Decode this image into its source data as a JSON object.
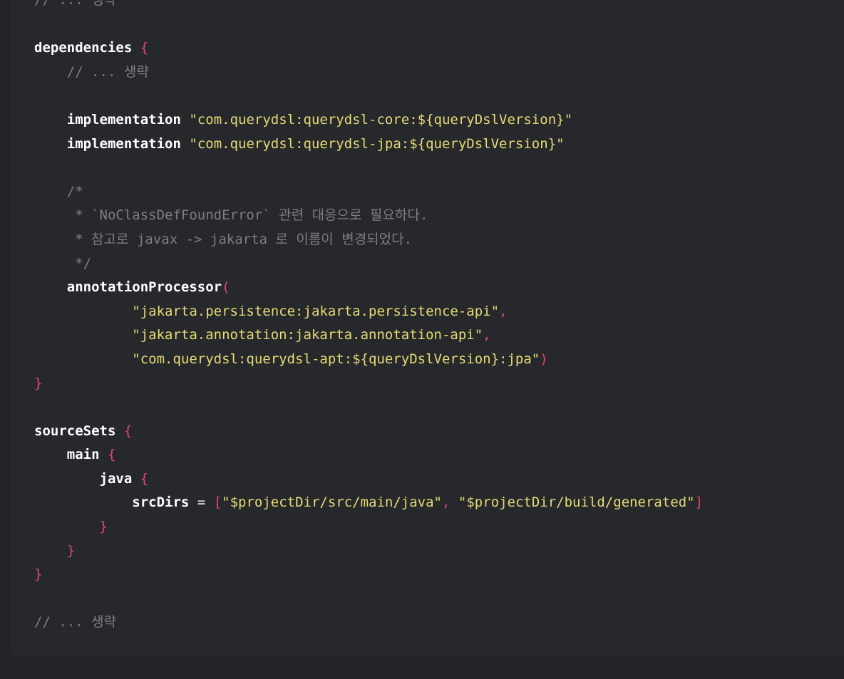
{
  "colors": {
    "page_background": "#222326",
    "code_background": "#26282c",
    "keyword": "#ffffff",
    "string": "#e6db74",
    "punctuation": "#e0476d",
    "comment": "#7c7e82"
  },
  "code_lines": [
    {
      "tokens": [
        {
          "t": "cmt",
          "v": "// ... 생략"
        }
      ]
    },
    {
      "tokens": []
    },
    {
      "tokens": [
        {
          "t": "kw",
          "v": "dependencies"
        },
        {
          "t": "op",
          "v": " "
        },
        {
          "t": "punc",
          "v": "{"
        }
      ]
    },
    {
      "tokens": [
        {
          "t": "op",
          "v": "    "
        },
        {
          "t": "cmt",
          "v": "// ... 생략"
        }
      ]
    },
    {
      "tokens": []
    },
    {
      "tokens": [
        {
          "t": "op",
          "v": "    "
        },
        {
          "t": "kw",
          "v": "implementation"
        },
        {
          "t": "op",
          "v": " "
        },
        {
          "t": "str",
          "v": "\"com.querydsl:querydsl-core:${queryDslVersion}\""
        }
      ]
    },
    {
      "tokens": [
        {
          "t": "op",
          "v": "    "
        },
        {
          "t": "kw",
          "v": "implementation"
        },
        {
          "t": "op",
          "v": " "
        },
        {
          "t": "str",
          "v": "\"com.querydsl:querydsl-jpa:${queryDslVersion}\""
        }
      ]
    },
    {
      "tokens": []
    },
    {
      "tokens": [
        {
          "t": "op",
          "v": "    "
        },
        {
          "t": "cmt",
          "v": "/*"
        }
      ]
    },
    {
      "tokens": [
        {
          "t": "op",
          "v": "     "
        },
        {
          "t": "cmt",
          "v": "* `NoClassDefFoundError` 관련 대응으로 필요하다."
        }
      ]
    },
    {
      "tokens": [
        {
          "t": "op",
          "v": "     "
        },
        {
          "t": "cmt",
          "v": "* 참고로 javax -> jakarta 로 이름이 변경되었다."
        }
      ]
    },
    {
      "tokens": [
        {
          "t": "op",
          "v": "     "
        },
        {
          "t": "cmt",
          "v": "*/"
        }
      ]
    },
    {
      "tokens": [
        {
          "t": "op",
          "v": "    "
        },
        {
          "t": "kw",
          "v": "annotationProcessor"
        },
        {
          "t": "punc",
          "v": "("
        }
      ]
    },
    {
      "tokens": [
        {
          "t": "op",
          "v": "            "
        },
        {
          "t": "str",
          "v": "\"jakarta.persistence:jakarta.persistence-api\""
        },
        {
          "t": "punc",
          "v": ","
        }
      ]
    },
    {
      "tokens": [
        {
          "t": "op",
          "v": "            "
        },
        {
          "t": "str",
          "v": "\"jakarta.annotation:jakarta.annotation-api\""
        },
        {
          "t": "punc",
          "v": ","
        }
      ]
    },
    {
      "tokens": [
        {
          "t": "op",
          "v": "            "
        },
        {
          "t": "str",
          "v": "\"com.querydsl:querydsl-apt:${queryDslVersion}:jpa\""
        },
        {
          "t": "punc",
          "v": ")"
        }
      ]
    },
    {
      "tokens": [
        {
          "t": "punc",
          "v": "}"
        }
      ]
    },
    {
      "tokens": []
    },
    {
      "tokens": [
        {
          "t": "kw",
          "v": "sourceSets"
        },
        {
          "t": "op",
          "v": " "
        },
        {
          "t": "punc",
          "v": "{"
        }
      ]
    },
    {
      "tokens": [
        {
          "t": "op",
          "v": "    "
        },
        {
          "t": "kw",
          "v": "main"
        },
        {
          "t": "op",
          "v": " "
        },
        {
          "t": "punc",
          "v": "{"
        }
      ]
    },
    {
      "tokens": [
        {
          "t": "op",
          "v": "        "
        },
        {
          "t": "kw",
          "v": "java"
        },
        {
          "t": "op",
          "v": " "
        },
        {
          "t": "punc",
          "v": "{"
        }
      ]
    },
    {
      "tokens": [
        {
          "t": "op",
          "v": "            "
        },
        {
          "t": "kw",
          "v": "srcDirs"
        },
        {
          "t": "op",
          "v": " = "
        },
        {
          "t": "punc",
          "v": "["
        },
        {
          "t": "str",
          "v": "\"$projectDir/src/main/java\""
        },
        {
          "t": "punc",
          "v": ", "
        },
        {
          "t": "str",
          "v": "\"$projectDir/build/generated\""
        },
        {
          "t": "punc",
          "v": "]"
        }
      ]
    },
    {
      "tokens": [
        {
          "t": "op",
          "v": "        "
        },
        {
          "t": "punc",
          "v": "}"
        }
      ]
    },
    {
      "tokens": [
        {
          "t": "op",
          "v": "    "
        },
        {
          "t": "punc",
          "v": "}"
        }
      ]
    },
    {
      "tokens": [
        {
          "t": "punc",
          "v": "}"
        }
      ]
    },
    {
      "tokens": []
    },
    {
      "tokens": [
        {
          "t": "cmt",
          "v": "// ... 생략"
        }
      ]
    }
  ]
}
